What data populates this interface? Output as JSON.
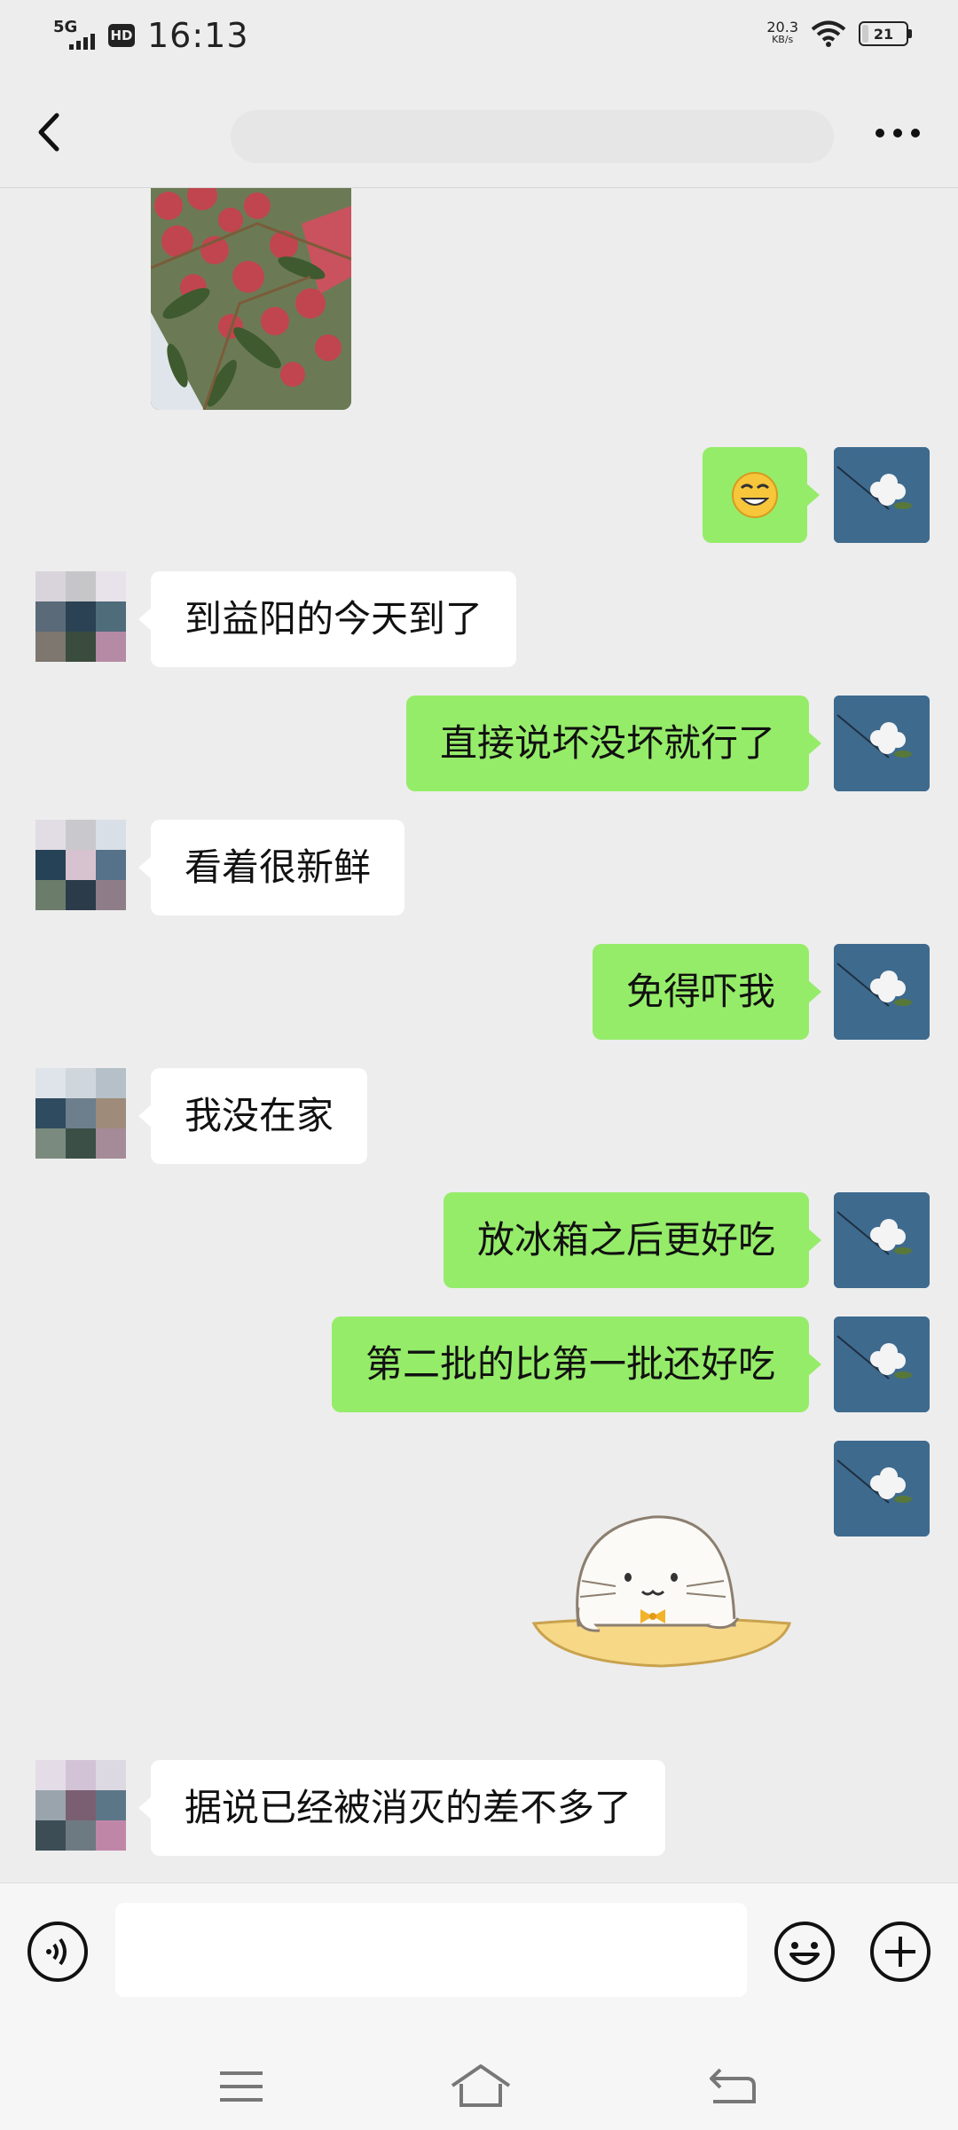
{
  "status_bar": {
    "network": "5G",
    "hd_badge": "HD",
    "time": "16:13",
    "speed_value": "20.3",
    "speed_unit": "KB/s",
    "battery": "21",
    "battery_level_percent": 21
  },
  "header": {
    "contact_name": "",
    "back_icon": "chevron-left-icon",
    "more_icon": "more-dots-icon"
  },
  "messages": [
    {
      "side": "left",
      "type": "image",
      "description_icon": "photo-thumbnail"
    },
    {
      "side": "right",
      "type": "emoji",
      "icon": "grin-emoji"
    },
    {
      "side": "left",
      "type": "text",
      "text": "到益阳的今天到了"
    },
    {
      "side": "right",
      "type": "text",
      "text": "直接说坏没坏就行了"
    },
    {
      "side": "left",
      "type": "text",
      "text": "看着很新鲜"
    },
    {
      "side": "right",
      "type": "text",
      "text": "免得吓我"
    },
    {
      "side": "left",
      "type": "text",
      "text": "我没在家"
    },
    {
      "side": "right",
      "type": "text",
      "text": "放冰箱之后更好吃"
    },
    {
      "side": "right",
      "type": "text",
      "text": "第二批的比第一批还好吃"
    },
    {
      "side": "right",
      "type": "sticker",
      "icon": "seal-sticker"
    },
    {
      "side": "left",
      "type": "text",
      "text": "据说已经被消灭的差不多了"
    }
  ],
  "input_bar": {
    "placeholder": "",
    "voice_icon": "voice-icon",
    "emoji_icon": "smiley-icon",
    "add_icon": "plus-icon"
  },
  "system_nav": {
    "menu_icon": "menu-icon",
    "home_icon": "home-icon",
    "back_icon": "back-arrow-icon"
  },
  "colors": {
    "background": "#ededed",
    "bubble_right": "#95ec69",
    "bubble_left": "#ffffff",
    "avatar_right": "#3e6a8e"
  }
}
